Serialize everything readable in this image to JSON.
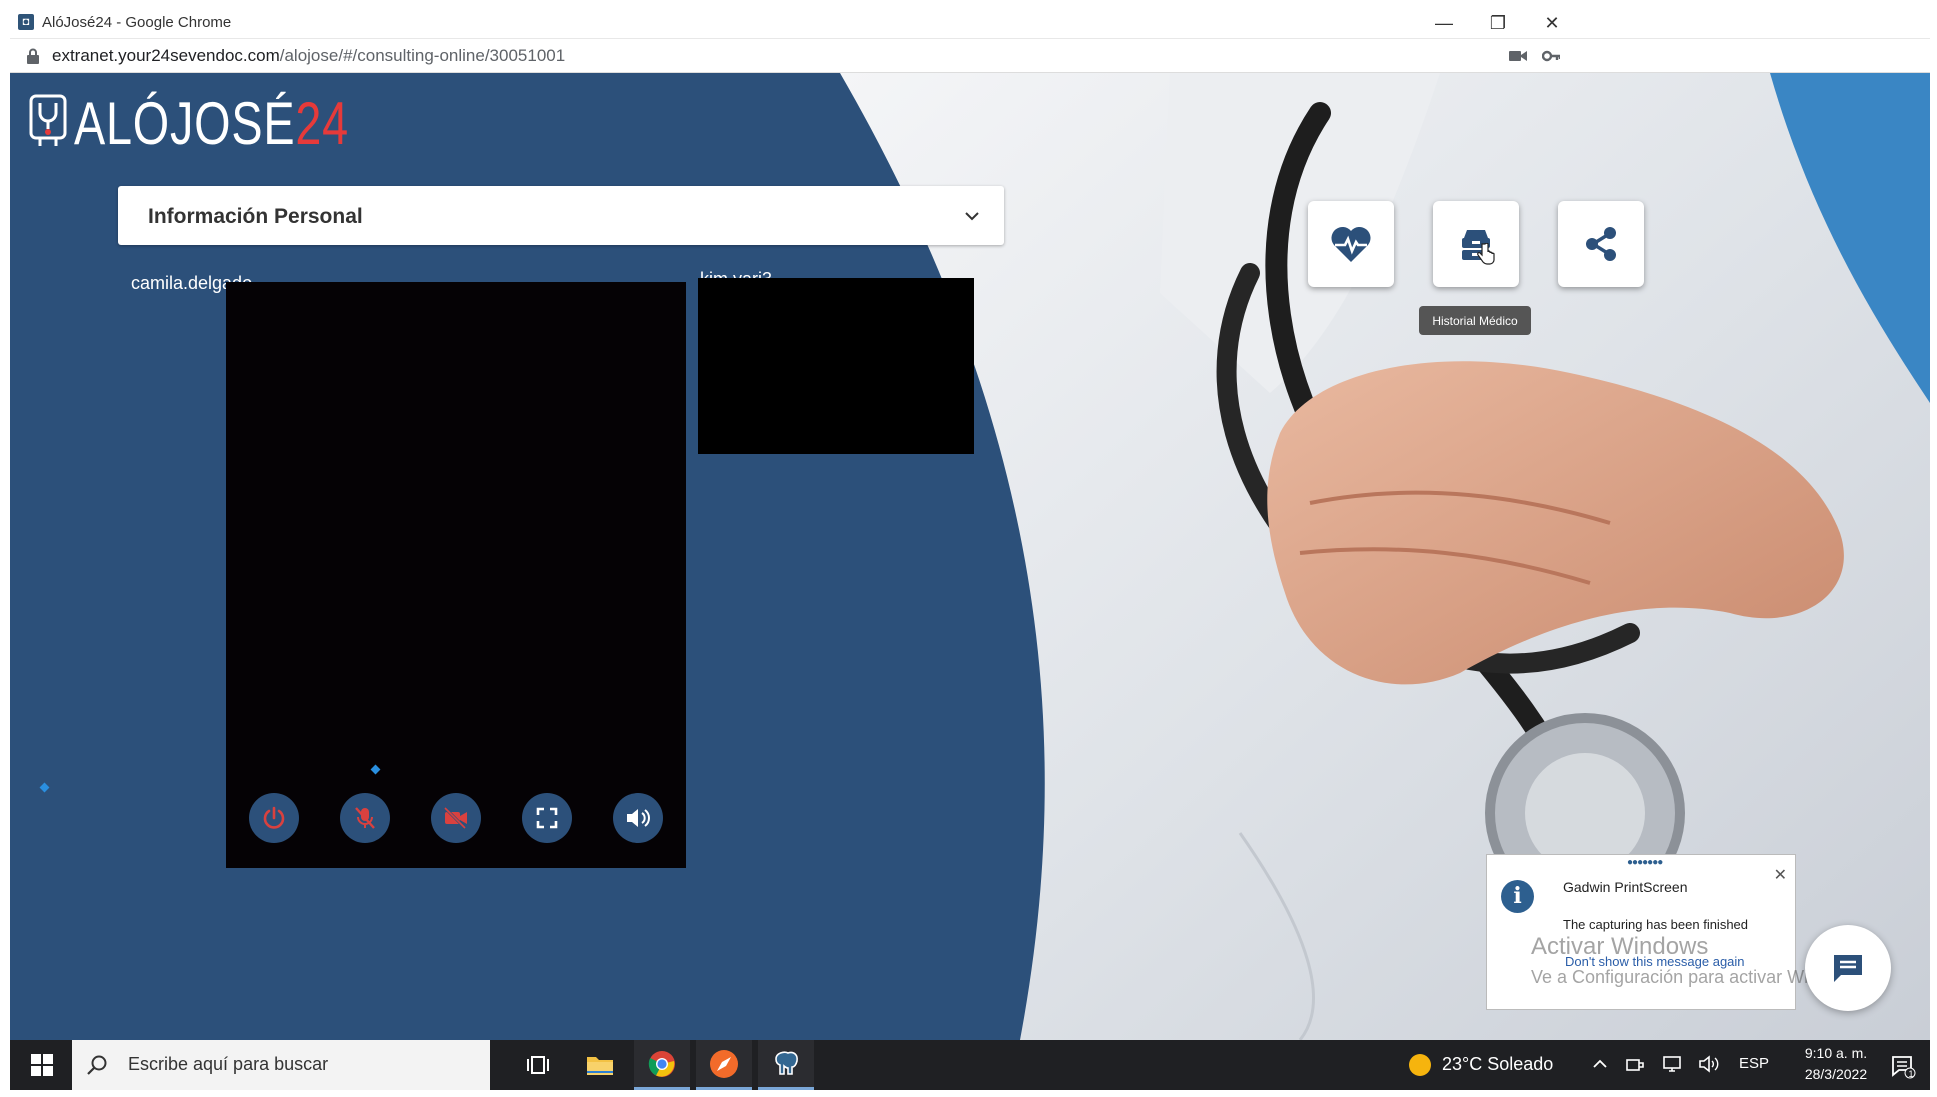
{
  "browser": {
    "window_title": "AlóJosé24 - Google Chrome",
    "url_host": "extranet.your24sevendoc.com",
    "url_path": "/alojose/#/consulting-online/30051001"
  },
  "app": {
    "logo_text": "ALÓJOSÉ",
    "logo_number": "24",
    "info_section_label": "Información Personal",
    "main_participant": "camila.delgado",
    "side_participant": "kim.yari3",
    "tooltip": "Historial Médico",
    "colors": {
      "page_blue": "#2c507a",
      "accent_red": "#e63a3a"
    }
  },
  "video_controls": [
    {
      "name": "power-icon",
      "color": "#d9413f"
    },
    {
      "name": "mic-off-icon",
      "color": "#d9413f"
    },
    {
      "name": "camera-off-icon",
      "color": "#d9413f"
    },
    {
      "name": "fullscreen-icon",
      "color": "#ffffff"
    },
    {
      "name": "volume-icon",
      "color": "#ffffff"
    }
  ],
  "action_buttons": [
    {
      "name": "heart-rate-icon"
    },
    {
      "name": "medical-history-icon"
    },
    {
      "name": "share-icon"
    }
  ],
  "notification": {
    "title": "Gadwin PrintScreen",
    "message": "The capturing has been finished",
    "link": "Don't show this message again",
    "close": "✕"
  },
  "watermark": {
    "line1": "Activar Windows",
    "line2": "Ve a Configuración para activar Windows."
  },
  "taskbar": {
    "search_placeholder": "Escribe aquí para buscar",
    "weather": "23°C  Soleado",
    "language": "ESP",
    "time": "9:10 a. m.",
    "date": "28/3/2022",
    "notification_count": "1"
  }
}
